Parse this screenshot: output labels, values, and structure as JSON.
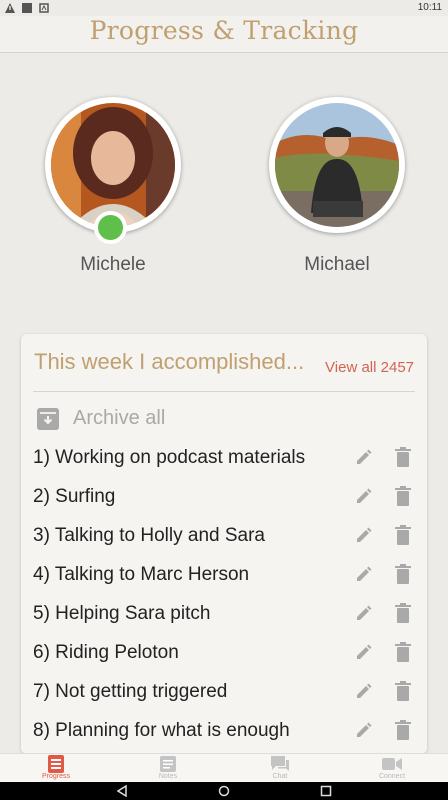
{
  "status_bar": {
    "time": "10:11"
  },
  "header": {
    "title": "Progress & Tracking"
  },
  "profiles": [
    {
      "name": "Michele",
      "online": true
    },
    {
      "name": "Michael",
      "online": false
    }
  ],
  "card": {
    "title": "This week I accomplished...",
    "view_all": "View all 2457",
    "archive_label": "Archive all",
    "items": [
      "1) Working on podcast materials",
      "2) Surfing",
      "3) Talking to Holly and Sara",
      "4) Talking to Marc Herson",
      "5) Helping Sara pitch",
      "6) Riding Peloton",
      "7) Not getting triggered",
      "8) Planning for what is enough"
    ]
  },
  "tabs": [
    {
      "label": "Progress",
      "icon": "progress-icon",
      "active": true
    },
    {
      "label": "Notes",
      "icon": "notes-icon",
      "active": false
    },
    {
      "label": "Chat",
      "icon": "chat-icon",
      "active": false
    },
    {
      "label": "Connect",
      "icon": "video-icon",
      "active": false
    }
  ],
  "colors": {
    "accent_gold": "#c0a070",
    "accent_red": "#e05a45",
    "online_green": "#5fbf4a",
    "background": "#ecebe8"
  }
}
